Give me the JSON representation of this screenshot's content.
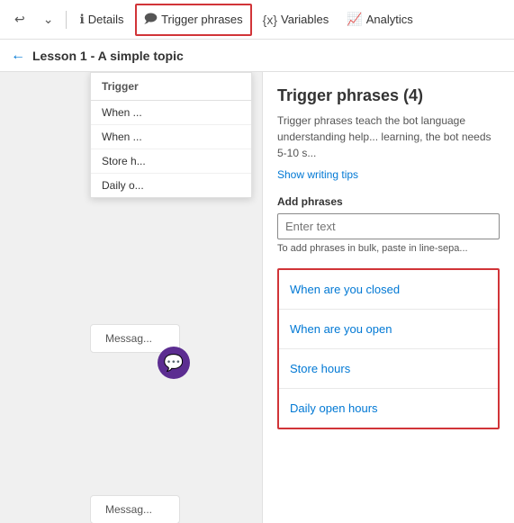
{
  "toolbar": {
    "undo_label": "↩",
    "dropdown_label": "⌄",
    "details_label": "Details",
    "trigger_phrases_label": "Trigger phrases",
    "variables_label": "Variables",
    "analytics_label": "Analytics"
  },
  "breadcrumb": {
    "back_label": "←",
    "page_title": "Lesson 1 - A simple topic"
  },
  "dropdown": {
    "header": "Trigger",
    "items": [
      "When ...",
      "When ...",
      "Store h...",
      "Daily o..."
    ]
  },
  "canvas": {
    "message_label_1": "Messag...",
    "message_label_2": "Messag..."
  },
  "right_panel": {
    "title": "Trigger phrases (4)",
    "description": "Trigger phrases teach the bot language understanding help... learning, the bot needs 5-10 s...",
    "show_tips_label": "Show writing tips",
    "add_phrases_label": "Add phrases",
    "input_placeholder": "Enter text",
    "bulk_hint": "To add phrases in bulk, paste in line-sepa...",
    "phrases": [
      "When are you closed",
      "When are you open",
      "Store hours",
      "Daily open hours"
    ]
  }
}
